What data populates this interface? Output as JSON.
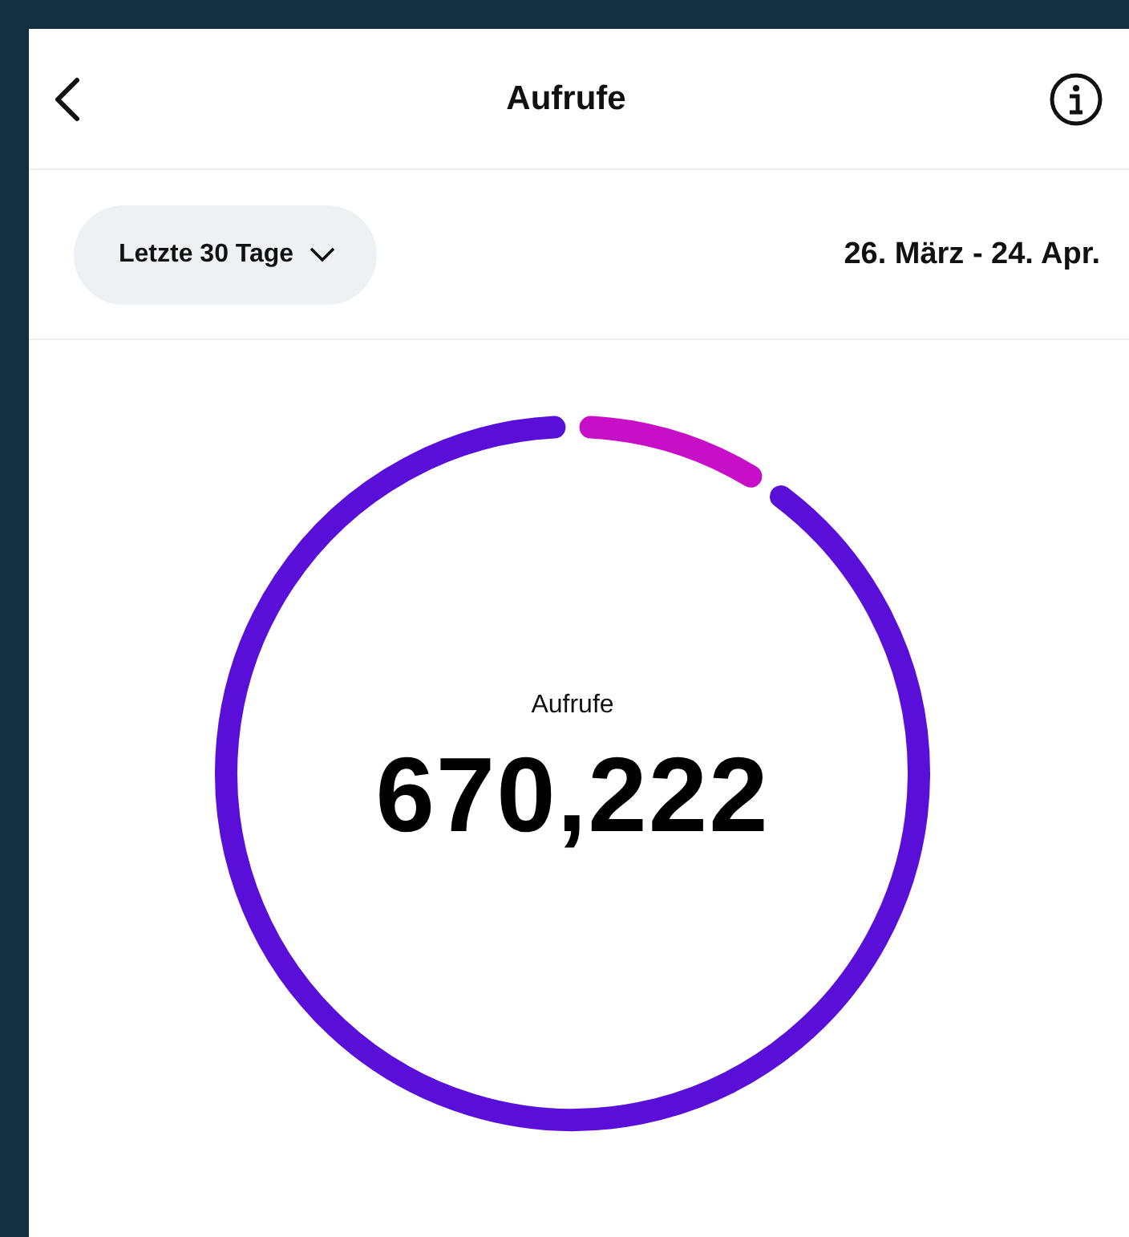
{
  "header": {
    "title": "Aufrufe"
  },
  "filter": {
    "label": "Letzte 30 Tage",
    "date_range": "26. März - 24. Apr."
  },
  "summary": {
    "label": "Aufrufe",
    "total": "670,222"
  }
}
